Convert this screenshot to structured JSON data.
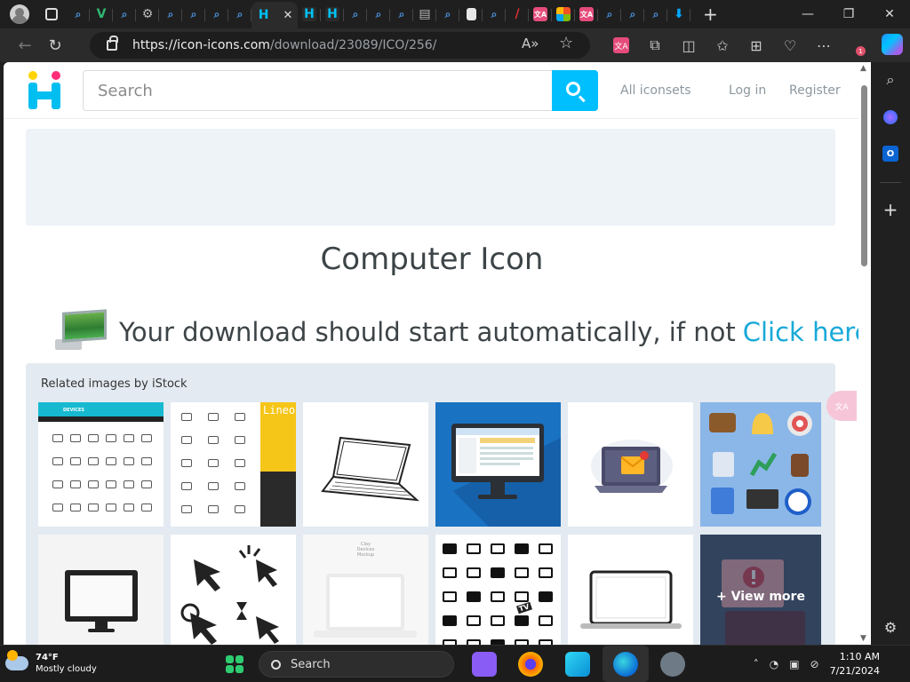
{
  "browser": {
    "url_host": "https://icon-icons.com",
    "url_path": "/download/23089/ICO/256/",
    "tab_icons": [
      "search-icon",
      "vectorizer-icon",
      "search-icon",
      "gear-icon",
      "search-icon",
      "search-icon",
      "search-icon",
      "search-icon",
      "icon-icons-logo",
      "icon-icons-logo",
      "icon-icons-logo",
      "search-icon",
      "search-icon",
      "search-icon",
      "book-icon",
      "search-icon",
      "page-icon",
      "search-icon",
      "red-slash-icon",
      "translate-icon",
      "microsoft-icon",
      "translate-icon",
      "search-icon",
      "search-icon",
      "search-icon",
      "download-icon"
    ]
  },
  "header": {
    "search_placeholder": "Search",
    "nav": [
      "All iconsets",
      "Log in",
      "Register"
    ]
  },
  "main": {
    "title": "Computer Icon",
    "download_text": "Your download should start automatically, if not",
    "download_link": "Click here"
  },
  "related": {
    "heading": "Related images by iStock",
    "view_more": "+ View more"
  },
  "thumbs": {
    "devices_header": "DEVICES",
    "lineo": "Lineo",
    "clay": "Clay\nDevices\nMockup",
    "tv": "TV"
  },
  "taskbar": {
    "temp": "74°F",
    "weather": "Mostly cloudy",
    "search": "Search",
    "time": "1:10 AM",
    "date": "7/21/2024"
  },
  "colors": {
    "accent": "#00bfff",
    "link": "#18a9d8",
    "ad_bg": "#eef3f8",
    "related_bg": "#e3eaf1"
  }
}
